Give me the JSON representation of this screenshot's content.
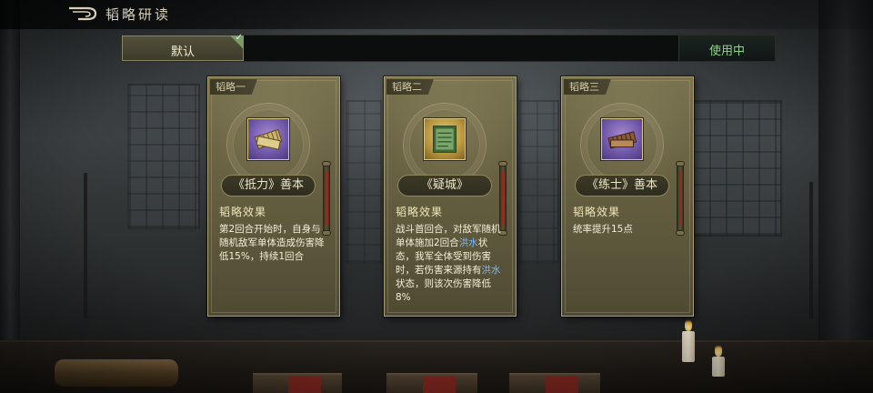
{
  "header": {
    "title": "韬略研读",
    "back_icon": "back-arrow-icon"
  },
  "scheme_bar": {
    "active_tab_label": "默认",
    "active_check_icon": "checkmark-icon",
    "status_button_label": "使用中"
  },
  "colors": {
    "in_use_text": "#8fd48a",
    "keyword_text": "#7fb8f0",
    "card_body": "#6c6545"
  },
  "cards": [
    {
      "tag": "韬略一",
      "icon": "purple-book-icon",
      "name": "《抵力》善本",
      "effect_title": "韬略效果",
      "effect_text": "第2回合开始时，自身与随机敌军单体造成伤害降低15%，持续1回合"
    },
    {
      "tag": "韬略二",
      "icon": "gold-book-icon",
      "name": "《疑城》",
      "effect_title": "韬略效果",
      "effect_parts": [
        "战斗首回合，对敌军随机单体施加2回合",
        "洪水",
        "状态，我军全体受到伤害时，若伤害来源持有",
        "洪水",
        "状态，则该次伤害降低8%"
      ]
    },
    {
      "tag": "韬略三",
      "icon": "purple-book-icon",
      "name": "《练士》善本",
      "effect_title": "韬略效果",
      "effect_text": "统率提升15点"
    }
  ]
}
